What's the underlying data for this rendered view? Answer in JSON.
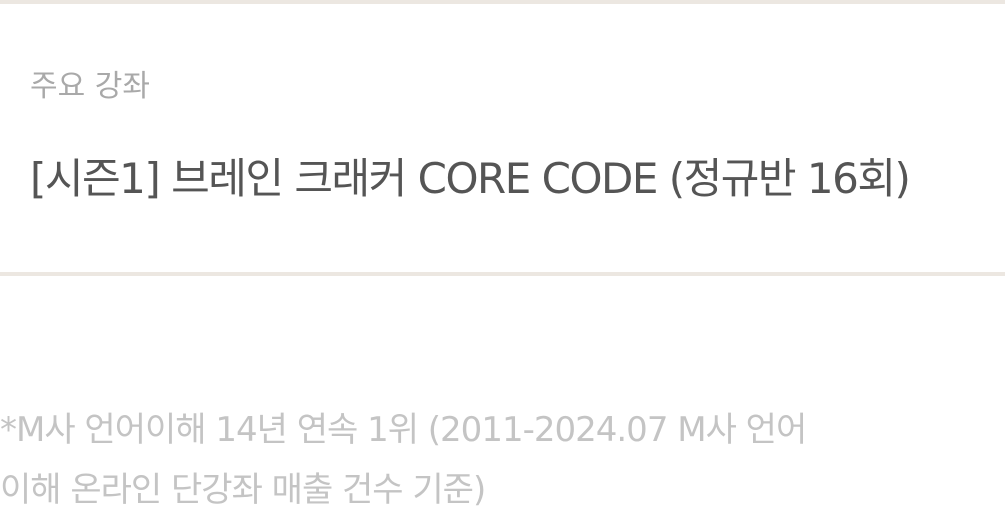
{
  "course_section": {
    "label": "주요 강좌",
    "title": "[시즌1] 브레인 크래커 CORE CODE (정규반 16회)"
  },
  "footnote": {
    "line1": "*M사 언어이해 14년 연속 1위 (2011-2024.07 M사 언어",
    "line2": "이해 온라인 단강좌 매출 건수 기준)"
  },
  "colors": {
    "divider": "#ece7e1",
    "label": "#a9a9a9",
    "title": "#555555",
    "footnote": "#c4c4c4"
  }
}
